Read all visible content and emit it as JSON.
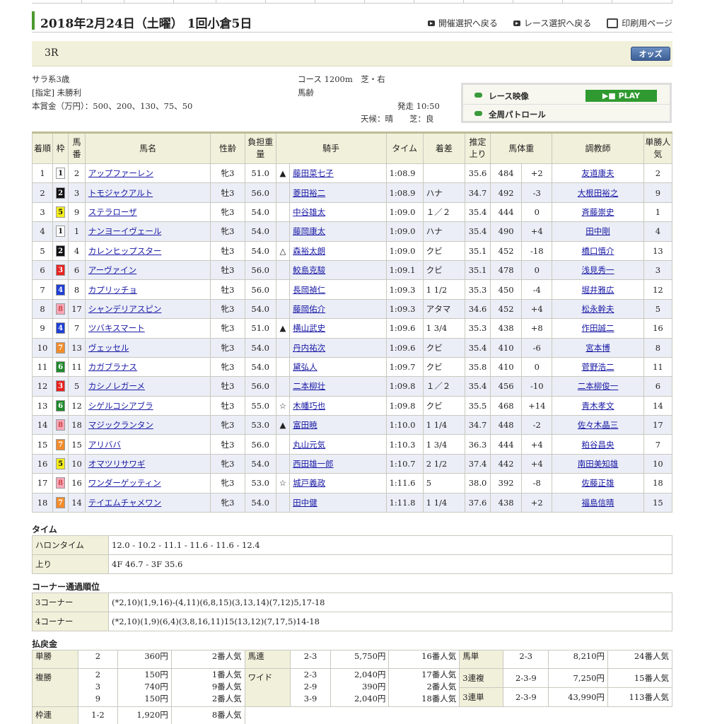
{
  "header": {
    "date": "2018年2月24日（土曜） 1回小倉5日",
    "nav": [
      "開催選択へ戻る",
      "レース選択へ戻る",
      "印刷用ページ"
    ]
  },
  "race": {
    "number": "3R",
    "odds_label": "オッズ"
  },
  "conditions": {
    "class": "サラ系3歳",
    "type": "[指定] 未勝利",
    "prize": "本賞金（万円）：500、200、130、75、50",
    "course": "コース 1200m　芝・右",
    "age": "馬齢",
    "start": "発走 10:50",
    "weather": "天候：晴　　芝：良"
  },
  "video": {
    "race_video": "レース映像",
    "play": "PLAY",
    "patrol": "全周パトロール"
  },
  "table": {
    "headers": [
      "着順",
      "枠",
      "馬番",
      "馬名",
      "性齢",
      "負担重量",
      "騎手",
      "タイム",
      "着差",
      "推定上り",
      "馬体重",
      "調教師",
      "単勝人気"
    ],
    "rows": [
      {
        "pos": "1",
        "waku": "1",
        "num": "2",
        "horse": "アップファーレン",
        "sex": "牝3",
        "wt": "51.0",
        "mark": "▲",
        "jockey": "藤田菜七子",
        "time": "1:08.9",
        "margin": "",
        "last": "35.6",
        "bw": "484",
        "diff": "+2",
        "trainer": "友道康夫",
        "pop": "2"
      },
      {
        "pos": "2",
        "waku": "2",
        "num": "3",
        "horse": "トモジャクアルト",
        "sex": "牡3",
        "wt": "56.0",
        "mark": "",
        "jockey": "菱田裕二",
        "time": "1:08.9",
        "margin": "ハナ",
        "last": "34.7",
        "bw": "492",
        "diff": "-3",
        "trainer": "大根田裕之",
        "pop": "9"
      },
      {
        "pos": "3",
        "waku": "5",
        "num": "9",
        "horse": "ステラローザ",
        "sex": "牝3",
        "wt": "54.0",
        "mark": "",
        "jockey": "中谷雄太",
        "time": "1:09.0",
        "margin": "１／２",
        "last": "35.4",
        "bw": "444",
        "diff": "0",
        "trainer": "斉藤崇史",
        "pop": "1"
      },
      {
        "pos": "4",
        "waku": "1",
        "num": "1",
        "horse": "ナンヨーイヴェール",
        "sex": "牝3",
        "wt": "54.0",
        "mark": "",
        "jockey": "藤岡康太",
        "time": "1:09.0",
        "margin": "ハナ",
        "last": "35.4",
        "bw": "490",
        "diff": "+4",
        "trainer": "田中剛",
        "pop": "4"
      },
      {
        "pos": "5",
        "waku": "2",
        "num": "4",
        "horse": "カレンヒップスター",
        "sex": "牡3",
        "wt": "54.0",
        "mark": "△",
        "jockey": "森裕太朗",
        "time": "1:09.0",
        "margin": "クビ",
        "last": "35.1",
        "bw": "452",
        "diff": "-18",
        "trainer": "橋口慎介",
        "pop": "13"
      },
      {
        "pos": "6",
        "waku": "3",
        "num": "6",
        "horse": "アーヴァイン",
        "sex": "牡3",
        "wt": "56.0",
        "mark": "",
        "jockey": "鮫島克駿",
        "time": "1:09.1",
        "margin": "クビ",
        "last": "35.1",
        "bw": "478",
        "diff": "0",
        "trainer": "浅見秀一",
        "pop": "3"
      },
      {
        "pos": "7",
        "waku": "4",
        "num": "8",
        "horse": "カプリッチョ",
        "sex": "牡3",
        "wt": "56.0",
        "mark": "",
        "jockey": "長岡禎仁",
        "time": "1:09.3",
        "margin": "1 1/2",
        "last": "35.3",
        "bw": "450",
        "diff": "-4",
        "trainer": "堀井雅広",
        "pop": "12"
      },
      {
        "pos": "8",
        "waku": "8",
        "num": "17",
        "horse": "シャンデリアスピン",
        "sex": "牝3",
        "wt": "54.0",
        "mark": "",
        "jockey": "藤岡佑介",
        "time": "1:09.3",
        "margin": "アタマ",
        "last": "34.6",
        "bw": "452",
        "diff": "+4",
        "trainer": "松永幹夫",
        "pop": "5"
      },
      {
        "pos": "9",
        "waku": "4",
        "num": "7",
        "horse": "ツバキスマート",
        "sex": "牝3",
        "wt": "51.0",
        "mark": "▲",
        "jockey": "横山武史",
        "time": "1:09.6",
        "margin": "1 3/4",
        "last": "35.3",
        "bw": "438",
        "diff": "+8",
        "trainer": "作田誠二",
        "pop": "16"
      },
      {
        "pos": "10",
        "waku": "7",
        "num": "13",
        "horse": "ヴェッセル",
        "sex": "牝3",
        "wt": "54.0",
        "mark": "",
        "jockey": "丹内祐次",
        "time": "1:09.6",
        "margin": "クビ",
        "last": "35.4",
        "bw": "410",
        "diff": "-6",
        "trainer": "宮本博",
        "pop": "8"
      },
      {
        "pos": "11",
        "waku": "6",
        "num": "11",
        "horse": "カガブラナス",
        "sex": "牝3",
        "wt": "54.0",
        "mark": "",
        "jockey": "黛弘人",
        "time": "1:09.7",
        "margin": "クビ",
        "last": "35.8",
        "bw": "410",
        "diff": "0",
        "trainer": "菅野浩二",
        "pop": "11"
      },
      {
        "pos": "12",
        "waku": "3",
        "num": "5",
        "horse": "カシノレガーメ",
        "sex": "牡3",
        "wt": "56.0",
        "mark": "",
        "jockey": "二本柳壮",
        "time": "1:09.8",
        "margin": "１／２",
        "last": "35.4",
        "bw": "456",
        "diff": "-10",
        "trainer": "二本柳俊一",
        "pop": "6"
      },
      {
        "pos": "13",
        "waku": "6",
        "num": "12",
        "horse": "シゲルコシアブラ",
        "sex": "牡3",
        "wt": "55.0",
        "mark": "☆",
        "jockey": "木幡巧也",
        "time": "1:09.8",
        "margin": "クビ",
        "last": "35.5",
        "bw": "468",
        "diff": "+14",
        "trainer": "青木孝文",
        "pop": "14"
      },
      {
        "pos": "14",
        "waku": "8",
        "num": "18",
        "horse": "マジックランタン",
        "sex": "牝3",
        "wt": "53.0",
        "mark": "▲",
        "jockey": "富田暁",
        "time": "1:10.0",
        "margin": "1 1/4",
        "last": "34.7",
        "bw": "448",
        "diff": "-2",
        "trainer": "佐々木晶三",
        "pop": "17"
      },
      {
        "pos": "15",
        "waku": "7",
        "num": "15",
        "horse": "アリババ",
        "sex": "牡3",
        "wt": "56.0",
        "mark": "",
        "jockey": "丸山元気",
        "time": "1:10.3",
        "margin": "1 3/4",
        "last": "36.3",
        "bw": "444",
        "diff": "+4",
        "trainer": "粕谷昌央",
        "pop": "7"
      },
      {
        "pos": "16",
        "waku": "5",
        "num": "10",
        "horse": "オマツリサワギ",
        "sex": "牝3",
        "wt": "54.0",
        "mark": "",
        "jockey": "西田雄一郎",
        "time": "1:10.7",
        "margin": "2 1/2",
        "last": "37.4",
        "bw": "442",
        "diff": "+4",
        "trainer": "南田美知雄",
        "pop": "10"
      },
      {
        "pos": "17",
        "waku": "8",
        "num": "16",
        "horse": "ワンダーゲッティン",
        "sex": "牝3",
        "wt": "53.0",
        "mark": "☆",
        "jockey": "城戸義政",
        "time": "1:11.6",
        "margin": "5",
        "last": "38.0",
        "bw": "392",
        "diff": "-8",
        "trainer": "佐藤正雄",
        "pop": "18"
      },
      {
        "pos": "18",
        "waku": "7",
        "num": "14",
        "horse": "テイエムチャメワン",
        "sex": "牝3",
        "wt": "54.0",
        "mark": "",
        "jockey": "田中健",
        "time": "1:11.8",
        "margin": "1 1/4",
        "last": "37.6",
        "bw": "438",
        "diff": "+2",
        "trainer": "福島信晴",
        "pop": "15"
      }
    ]
  },
  "waku_colors": {
    "1": "#ffffff",
    "2": "#111111",
    "3": "#e8221f",
    "4": "#1f3fd4",
    "5": "#f5ee1c",
    "6": "#1f8a2a",
    "7": "#f28c2a",
    "8": "#f6a8b8"
  },
  "time_section": {
    "title": "タイム",
    "rows": [
      {
        "k": "ハロンタイム",
        "v": "12.0 - 10.2 - 11.1 - 11.6 - 11.6 - 12.4"
      },
      {
        "k": "上り",
        "v": "4F 46.7 - 3F 35.6"
      }
    ]
  },
  "corner_section": {
    "title": "コーナー通過順位",
    "rows": [
      {
        "k": "3コーナー",
        "v": "(*2,10)(1,9,16)-(4,11)(6,8,15)(3,13,14)(7,12)5,17-18"
      },
      {
        "k": "4コーナー",
        "v": "(*2,10)(1,9)(6,4)(3,8,16,11)15(13,12)(7,17,5)14-18"
      }
    ]
  },
  "payout": {
    "title": "払戻金",
    "tansho": {
      "k": "単勝",
      "combo": "2",
      "yen": "360円",
      "pop": "2番人気"
    },
    "fukusho": {
      "k": "複勝",
      "combo": "2\n3\n9",
      "yen": "150円\n740円\n150円",
      "pop": "1番人気\n9番人気\n2番人気"
    },
    "wakuren": {
      "k": "枠連",
      "combo": "1-2",
      "yen": "1,920円",
      "pop": "8番人気"
    },
    "umaren": {
      "k": "馬連",
      "combo": "2-3",
      "yen": "5,750円",
      "pop": "16番人気"
    },
    "wide": {
      "k": "ワイド",
      "combo": "2-3\n2-9\n3-9",
      "yen": "2,040円\n390円\n2,040円",
      "pop": "17番人気\n2番人気\n18番人気"
    },
    "umatan": {
      "k": "馬単",
      "combo": "2-3",
      "yen": "8,210円",
      "pop": "24番人気"
    },
    "sanrenpuku": {
      "k": "3連複",
      "combo": "2-3-9",
      "yen": "7,250円",
      "pop": "15番人気"
    },
    "sanrentan": {
      "k": "3連単",
      "combo": "2-3-9",
      "yen": "43,990円",
      "pop": "113番人気"
    }
  }
}
